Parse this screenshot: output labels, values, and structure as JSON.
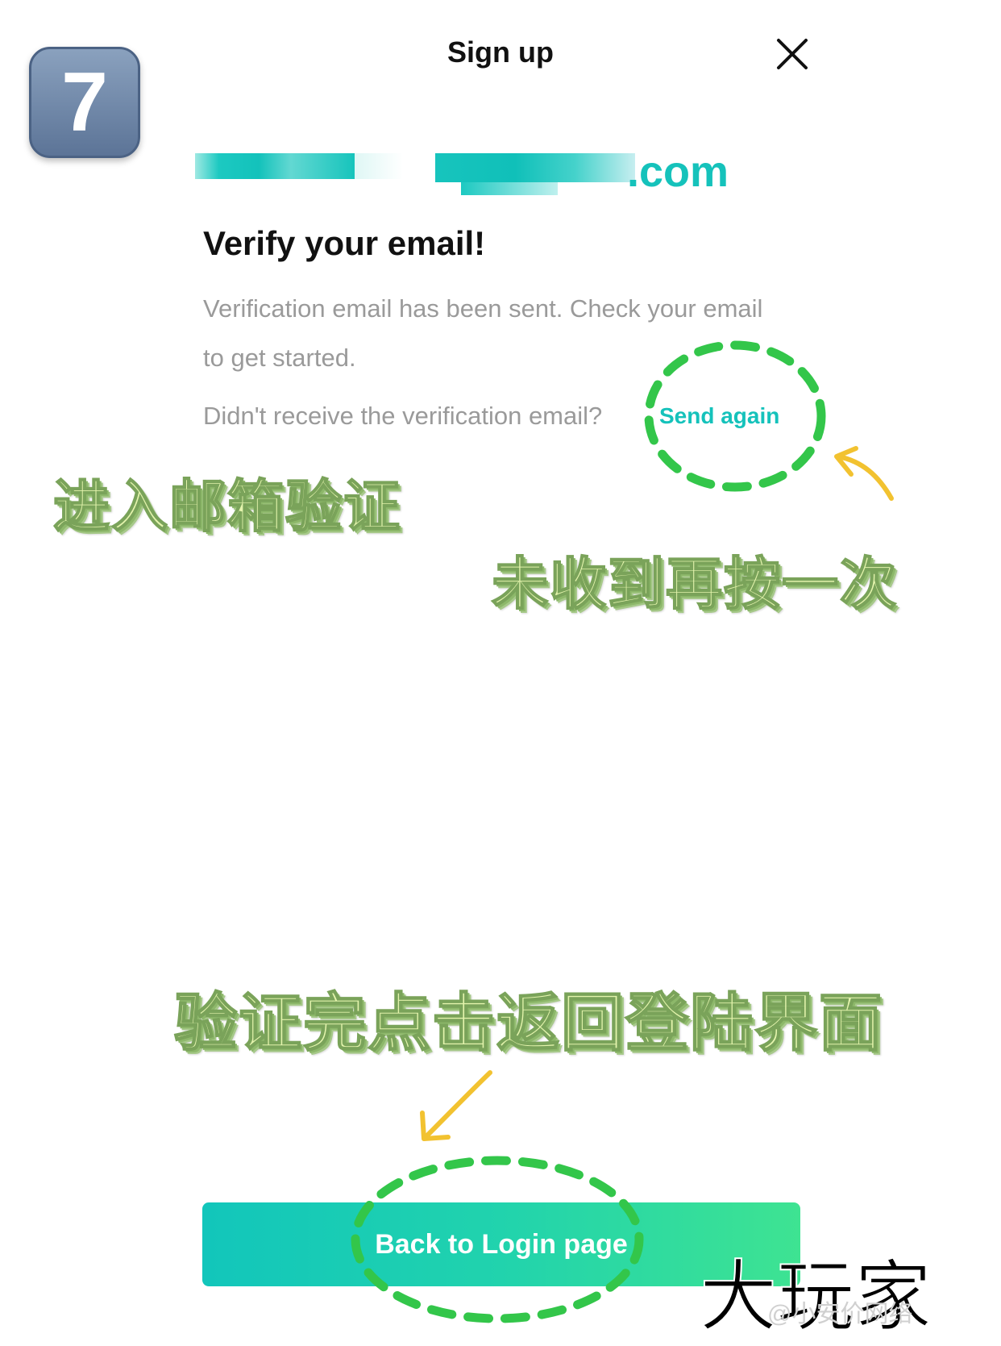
{
  "step_badge": {
    "number": "7"
  },
  "header": {
    "title": "Sign up",
    "close_icon": "close-icon"
  },
  "email": {
    "domain_suffix": ".com"
  },
  "verify": {
    "heading": "Verify your email!",
    "description": "Verification email has been sent. Check your email to get started.",
    "resend_prompt": "Didn't receive the verification email?",
    "send_again_label": "Send again"
  },
  "annotations": {
    "enter_mailbox": "进入邮箱验证",
    "not_received": "未收到再按一次",
    "after_verify": "验证完点击返回登陆界面"
  },
  "back_button": {
    "label": "Back to Login page"
  },
  "watermark": {
    "main": "大玩家",
    "sub": "@小安价网络"
  },
  "colors": {
    "accent": "#15c2bb",
    "button_start": "#12c6bb",
    "button_end": "#3ee392",
    "highlight_ring": "#33c64a",
    "arrow": "#f2c230"
  }
}
